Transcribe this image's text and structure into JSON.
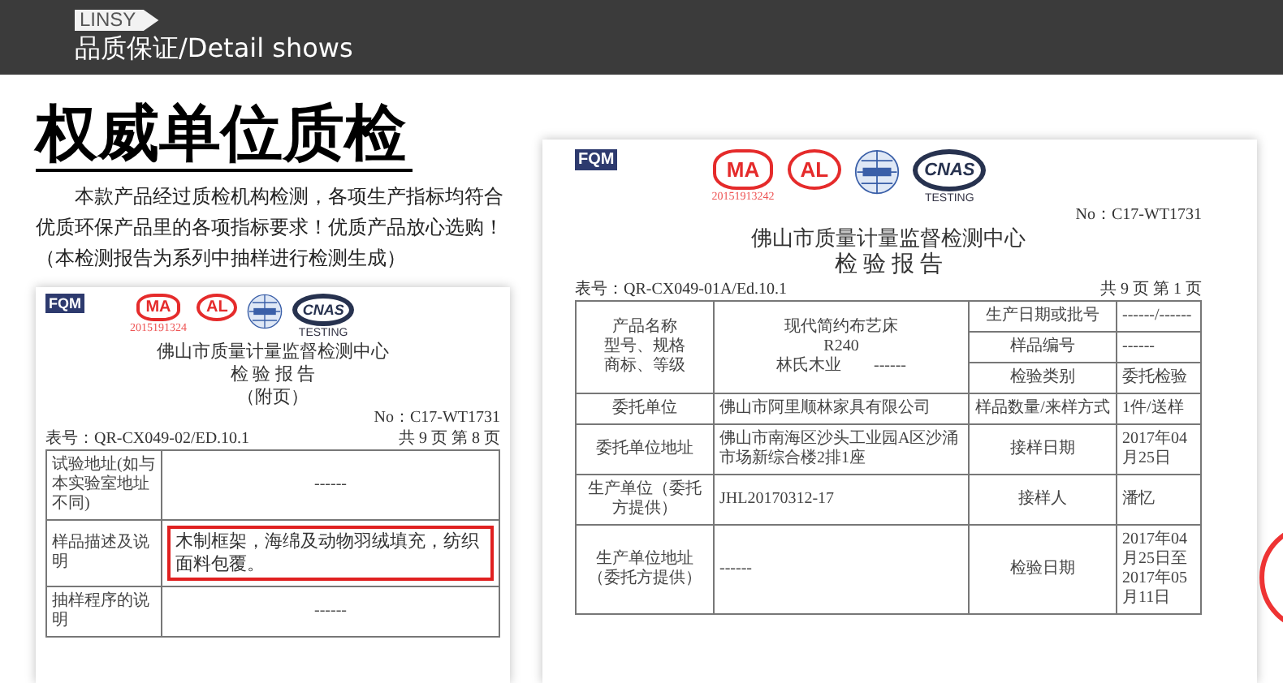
{
  "header": {
    "tag": "LINSY",
    "title": "品质保证/Detail shows"
  },
  "heading": "权威单位质检",
  "intro": "本款产品经过质检机构检测，各项生产指标均符合优质环保产品里的各项指标要求！优质产品放心选购！（本检测报告为系列中抽样进行检测生成）",
  "appendix_report": {
    "logos": [
      {
        "kind": "fqm",
        "text": "FQM"
      },
      {
        "kind": "cma",
        "text": "MA",
        "caption": "2015191324"
      },
      {
        "kind": "cal",
        "text": "AL"
      },
      {
        "kind": "ilac"
      },
      {
        "kind": "cnas",
        "text": "CNAS",
        "caption": "TESTING"
      }
    ],
    "org": "佛山市质量计量监督检测中心",
    "title": "检 验 报 告",
    "subtitle": "（附页）",
    "number": "No：C17-WT1731",
    "form": "表号：QR-CX049-02/ED.10.1",
    "page": "共 9 页 第 8 页",
    "rows": [
      {
        "label": "试验地址(如与本实验室地址不同)",
        "value": "------",
        "highlighted": false
      },
      {
        "label": "样品描述及说明",
        "value": "木制框架，海绵及动物羽绒填充，纺织面料包覆。",
        "highlighted": true
      },
      {
        "label": "抽样程序的说明",
        "value": "------",
        "highlighted": false
      }
    ]
  },
  "main_report": {
    "logos": [
      {
        "kind": "fqm",
        "text": "FQM"
      },
      {
        "kind": "cma",
        "text": "MA",
        "caption": "20151913242"
      },
      {
        "kind": "cal",
        "text": "AL"
      },
      {
        "kind": "ilac"
      },
      {
        "kind": "cnas",
        "text": "CNAS",
        "caption": "TESTING"
      }
    ],
    "number": "No：C17-WT1731",
    "org": "佛山市质量计量监督检测中心",
    "title": "检 验 报 告",
    "form": "表号：QR-CX049-01A/Ed.10.1",
    "page": "共 9 页 第 1 页",
    "product": {
      "labels": [
        "产品名称",
        "型号、规格",
        "商标、等级"
      ],
      "values": [
        "现代简约布艺床",
        "R240",
        "林氏木业　　------"
      ],
      "side": [
        {
          "label": "生产日期或批号",
          "value": "------/------"
        },
        {
          "label": "样品编号",
          "value": "------"
        },
        {
          "label": "检验类别",
          "value": "委托检验"
        }
      ]
    },
    "rows": [
      {
        "label": "委托单位",
        "value": "佛山市阿里顺林家具有限公司",
        "label2": "样品数量/来样方式",
        "value2": "1件/送样"
      },
      {
        "label": "委托单位地址",
        "value": "佛山市南海区沙头工业园A区沙涌市场新综合楼2排1座",
        "label2": "接样日期",
        "value2": "2017年04月25日"
      },
      {
        "label": "生产单位（委托方提供）",
        "value": "JHL20170312-17",
        "label2": "接样人",
        "value2": "潘忆"
      },
      {
        "label": "生产单位地址（委托方提供）",
        "value": "------",
        "label2": "检验日期",
        "value2": "2017年04月25日至2017年05月11日"
      }
    ]
  }
}
